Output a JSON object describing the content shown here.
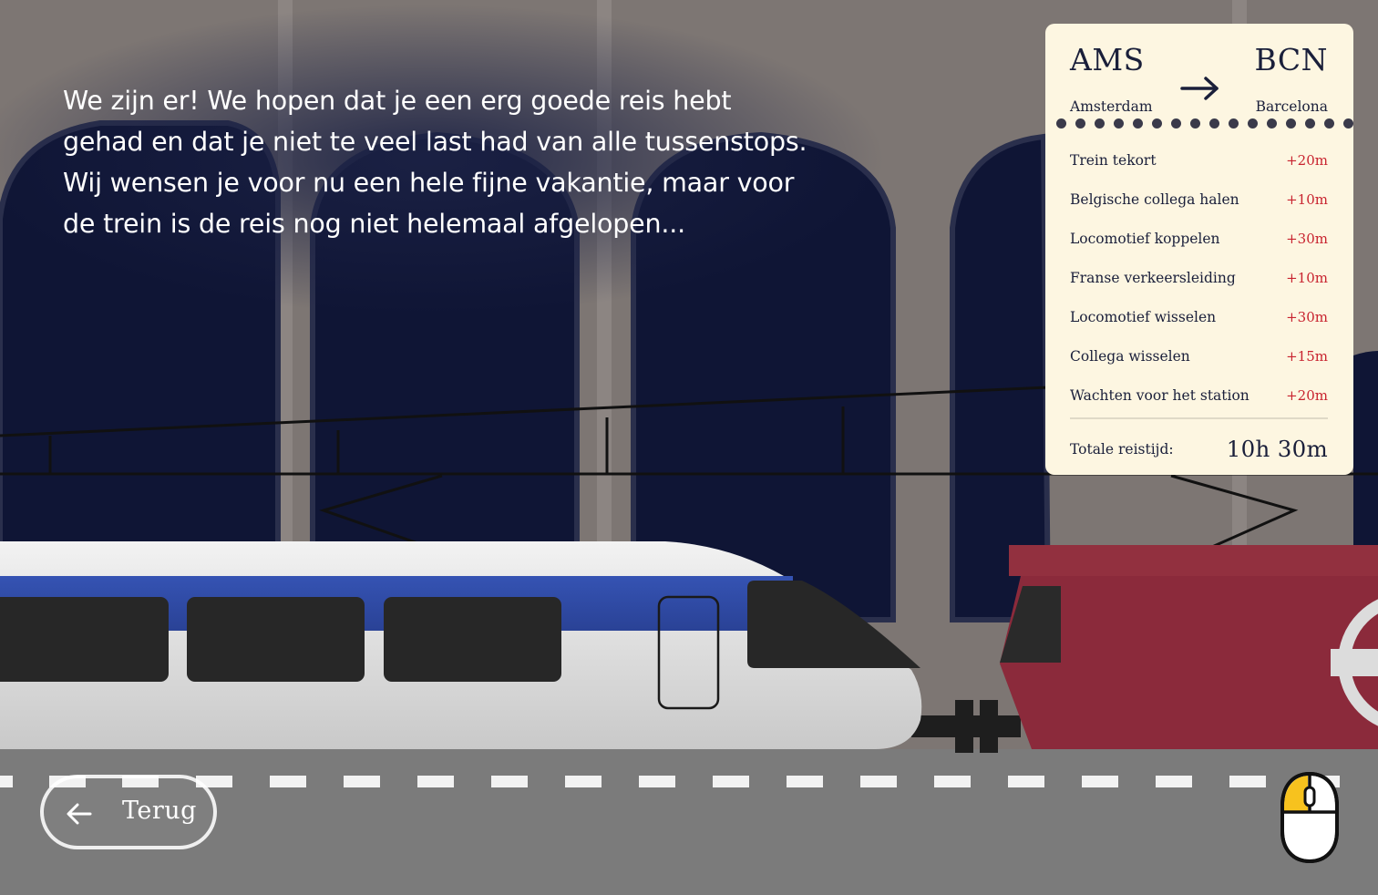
{
  "story": {
    "text": "We zijn er! We hopen dat je een erg goede reis hebt gehad en dat je niet te veel last had van alle tussenstops. Wij wensen je voor nu een hele fijne vakantie, maar voor de trein is de reis nog niet helemaal afgelopen..."
  },
  "ticket": {
    "from_code": "AMS",
    "from_city": "Amsterdam",
    "to_code": "BCN",
    "to_city": "Barcelona",
    "arrow_icon": "arrow-right-icon",
    "stops": [
      {
        "label": "Trein tekort",
        "delay": "+20m"
      },
      {
        "label": "Belgische collega halen",
        "delay": "+10m"
      },
      {
        "label": "Locomotief koppelen",
        "delay": "+30m"
      },
      {
        "label": "Franse verkeersleiding",
        "delay": "+10m"
      },
      {
        "label": "Locomotief wisselen",
        "delay": "+30m"
      },
      {
        "label": "Collega wisselen",
        "delay": "+15m"
      },
      {
        "label": "Wachten voor het station",
        "delay": "+20m"
      }
    ],
    "total_label": "Totale reistijd:",
    "total_value": "10h 30m"
  },
  "navigation": {
    "back_label": "Terug",
    "back_icon": "arrow-left-icon",
    "hint_icon": "mouse-scroll-icon"
  },
  "colors": {
    "night_sky": "#0f1535",
    "station_wall": "#7d7673",
    "train_stripe": "#2f4ca6",
    "locomotive_red": "#8b2a3b",
    "ticket_bg": "#fdf6e1",
    "delay_red": "#c8232f",
    "mouse_highlight": "#f7c21e"
  }
}
